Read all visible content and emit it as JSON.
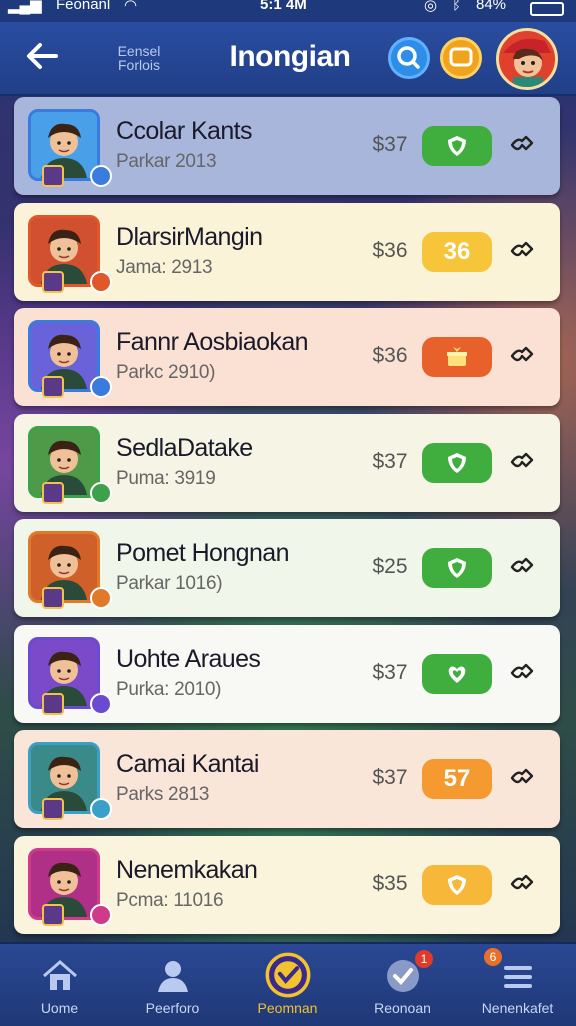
{
  "status_bar": {
    "carrier": "Feonanl",
    "time": "5:1 4M",
    "battery": "84%"
  },
  "header": {
    "back_icon": "back-arrow-icon",
    "subtitle": "Eensel Forlois",
    "title": "Inongian",
    "search_icon": "search-icon",
    "chat_icon": "chat-icon"
  },
  "list": [
    {
      "name": "Ccolar Kants",
      "meta": "Parkar 2013",
      "price": "$37",
      "pill_label": "",
      "pill_icon": "shield-icon",
      "pill_color": "#3fae3f",
      "row_bg": "#a8b6dc",
      "thumb_border": "#3a7be0",
      "thumb_bg": "#4aa0e8"
    },
    {
      "name": "DlarsirMangin",
      "meta": "Jama: 2913",
      "price": "$36",
      "pill_label": "36",
      "pill_icon": "",
      "pill_color": "#f7c53a",
      "row_bg": "#fbf3d8",
      "thumb_border": "#e0572a",
      "thumb_bg": "#d05030"
    },
    {
      "name": "Fannr Aosbiaokan",
      "meta": "Parkc 2910)",
      "price": "$36",
      "pill_label": "",
      "pill_icon": "gift-icon",
      "pill_color": "#e8602a",
      "row_bg": "#fbe0d4",
      "thumb_border": "#3a7be0",
      "thumb_bg": "#6a62d8"
    },
    {
      "name": "SedlaDatake",
      "meta": "Puma: 3919",
      "price": "$37",
      "pill_label": "",
      "pill_icon": "shield-icon",
      "pill_color": "#3fae3f",
      "row_bg": "#f6f4e4",
      "thumb_border": "#3da04a",
      "thumb_bg": "#4e9a48"
    },
    {
      "name": "Pomet Hongnan",
      "meta": "Parkar 1016)",
      "price": "$25",
      "pill_label": "",
      "pill_icon": "shield-icon",
      "pill_color": "#3fae3f",
      "row_bg": "#f0f6ea",
      "thumb_border": "#e07a2a",
      "thumb_bg": "#d0602a"
    },
    {
      "name": "Uohte Araues",
      "meta": "Purka: 2010)",
      "price": "$37",
      "pill_label": "",
      "pill_icon": "heart-icon",
      "pill_color": "#3fae3f",
      "row_bg": "#f8f8f4",
      "thumb_border": "#6a4ad0",
      "thumb_bg": "#7a4ac8"
    },
    {
      "name": "Camai Kantai",
      "meta": "Parks 2813",
      "price": "$37",
      "pill_label": "57",
      "pill_icon": "",
      "pill_color": "#f59a30",
      "row_bg": "#fae6d8",
      "thumb_border": "#3aa0c8",
      "thumb_bg": "#3a8a8a"
    },
    {
      "name": "Nenemkakan",
      "meta": "Pcma: 11016",
      "price": "$35",
      "pill_label": "",
      "pill_icon": "shield-icon",
      "pill_color": "#f7b83a",
      "row_bg": "#fbf4dc",
      "thumb_border": "#d03a8a",
      "thumb_bg": "#b03088"
    }
  ],
  "nav": [
    {
      "label": "Uome",
      "icon": "home-icon",
      "active": false
    },
    {
      "label": "Peerforo",
      "icon": "profile-icon",
      "active": false
    },
    {
      "label": "Peomnan",
      "icon": "check-badge-icon",
      "active": true
    },
    {
      "label": "Reonoan",
      "icon": "check-icon",
      "active": false,
      "badge": "1"
    },
    {
      "label": "Nenenkafet",
      "icon": "menu-icon",
      "active": false,
      "badge": "6"
    }
  ]
}
